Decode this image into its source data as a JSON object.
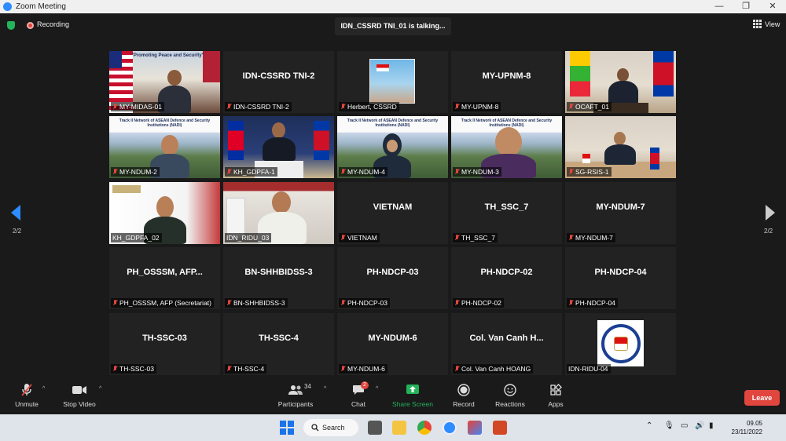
{
  "window": {
    "title": "Zoom Meeting",
    "min": "—",
    "max": "❐",
    "close": "✕"
  },
  "topbar": {
    "recording_label": "Recording",
    "talking": "IDN_CSSRD TNI_01 is talking...",
    "view_label": "View"
  },
  "pager": {
    "left": "2/2",
    "right": "2/2"
  },
  "tiles": [
    {
      "label": "MY-MIDAS-01",
      "muted": true,
      "video": "flag",
      "banner": "\"Promoting Peace and Security\""
    },
    {
      "label": "IDN-CSSRD TNI-2",
      "muted": true,
      "video": "none",
      "name": "IDN-CSSRD TNI-2"
    },
    {
      "label": "Herbert, CSSRD",
      "muted": true,
      "video": "photo"
    },
    {
      "label": "MY-UPNM-8",
      "muted": true,
      "video": "none",
      "name": "MY-UPNM-8"
    },
    {
      "label": "OCAFT_01",
      "muted": true,
      "video": "room"
    },
    {
      "label": "MY-NDUM-2",
      "muted": true,
      "video": "hill",
      "banner": "Track II Network of ASEAN Defence and Security Institutions (NADI)"
    },
    {
      "label": "KH_GDPFA-1",
      "muted": true,
      "video": "blue"
    },
    {
      "label": "MY-NDUM-4",
      "muted": true,
      "video": "hill",
      "banner": "Track II Network of ASEAN Defence and Security Institutions (NADI)"
    },
    {
      "label": "MY-NDUM-3",
      "muted": true,
      "video": "hill",
      "banner": "Track II Network of ASEAN Defence and Security Institutions (NADI)"
    },
    {
      "label": "SG-RSIS-1",
      "muted": true,
      "video": "room"
    },
    {
      "label": "KH_GDPFA_02",
      "muted": false,
      "video": "white"
    },
    {
      "label": "IDN_RIDU_03",
      "muted": false,
      "video": "build"
    },
    {
      "label": "VIETNAM",
      "muted": true,
      "video": "none",
      "name": "VIETNAM"
    },
    {
      "label": "TH_SSC_7",
      "muted": true,
      "video": "none",
      "name": "TH_SSC_7"
    },
    {
      "label": "MY-NDUM-7",
      "muted": true,
      "video": "none",
      "name": "MY-NDUM-7"
    },
    {
      "label": "PH_OSSSM, AFP (Secretariat)",
      "muted": true,
      "video": "none",
      "name": "PH_OSSSM, AFP..."
    },
    {
      "label": "BN-SHHBIDSS-3",
      "muted": true,
      "video": "none",
      "name": "BN-SHHBIDSS-3"
    },
    {
      "label": "PH-NDCP-03",
      "muted": true,
      "video": "none",
      "name": "PH-NDCP-03"
    },
    {
      "label": "PH-NDCP-02",
      "muted": true,
      "video": "none",
      "name": "PH-NDCP-02"
    },
    {
      "label": "PH-NDCP-04",
      "muted": true,
      "video": "none",
      "name": "PH-NDCP-04"
    },
    {
      "label": "TH-SSC-03",
      "muted": true,
      "video": "none",
      "name": "TH-SSC-03"
    },
    {
      "label": "TH-SSC-4",
      "muted": true,
      "video": "none",
      "name": "TH-SSC-4"
    },
    {
      "label": "MY-NDUM-6",
      "muted": true,
      "video": "none",
      "name": "MY-NDUM-6"
    },
    {
      "label": "Col. Van Canh HOANG",
      "muted": true,
      "video": "none",
      "name": "Col. Van Canh H..."
    },
    {
      "label": "IDN-RIDU-04",
      "muted": false,
      "video": "logo"
    }
  ],
  "toolbar": {
    "unmute": "Unmute",
    "stop_video": "Stop Video",
    "participants": "Participants",
    "participants_count": "34",
    "chat": "Chat",
    "chat_badge": "2",
    "share_screen": "Share Screen",
    "record": "Record",
    "reactions": "Reactions",
    "apps": "Apps",
    "leave": "Leave"
  },
  "taskbar": {
    "search": "Search",
    "time": "09.05",
    "date": "23/11/2022"
  },
  "colors": {
    "accent": "#2d8cff",
    "share_green": "#23b35a",
    "leave_red": "#e0463e"
  }
}
